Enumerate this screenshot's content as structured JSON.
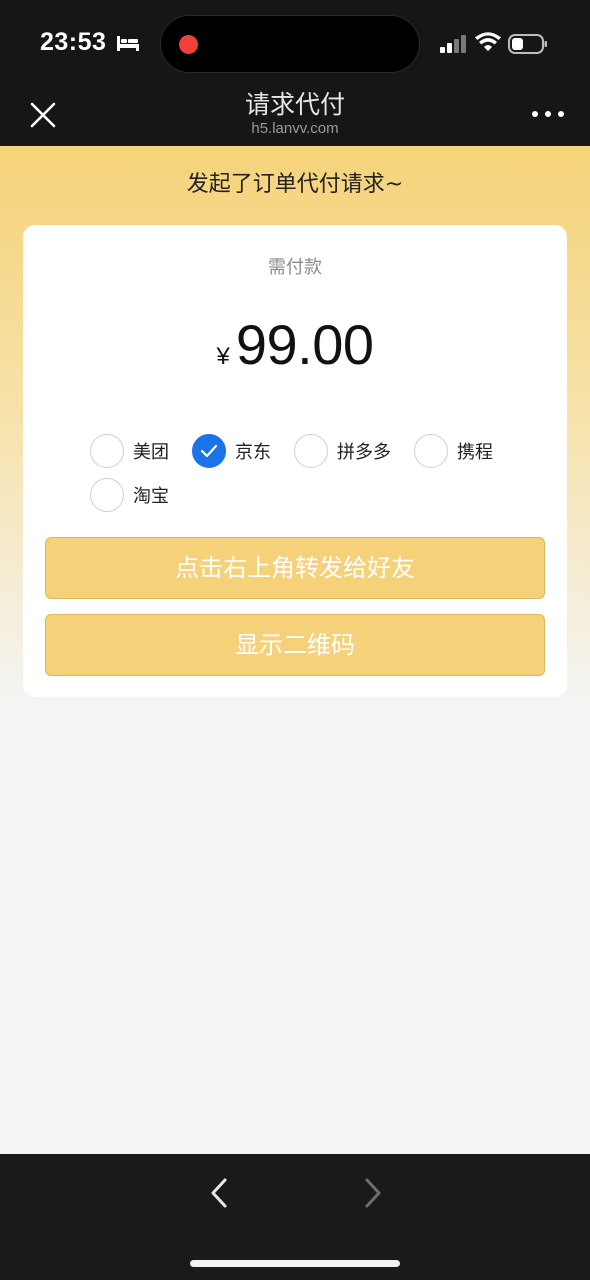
{
  "status_bar": {
    "time": "23:53",
    "icons": [
      "bed-icon",
      "recording-dot",
      "signal-icon",
      "wifi-icon",
      "battery-icon"
    ],
    "record_color": "#f0413a"
  },
  "nav": {
    "title": "请求代付",
    "subtitle": "h5.lanvv.com",
    "close_icon": "close-icon",
    "more_icon": "more-icon"
  },
  "hero": {
    "message": "发起了订单代付请求~"
  },
  "payment": {
    "label": "需付款",
    "currency": "¥",
    "amount": "99.00"
  },
  "platforms": [
    {
      "label": "美团",
      "checked": false
    },
    {
      "label": "京东",
      "checked": true
    },
    {
      "label": "拼多多",
      "checked": false
    },
    {
      "label": "携程",
      "checked": false
    },
    {
      "label": "淘宝",
      "checked": false
    }
  ],
  "buttons": {
    "share": "点击右上角转发给好友",
    "qr": "显示二维码"
  },
  "bottom_bar": {
    "back_icon": "chevron-left-icon",
    "forward_icon": "chevron-right-icon"
  },
  "colors": {
    "accent_yellow": "#f5d27a",
    "checked_blue": "#1a73e8",
    "dark_bar": "#161616"
  }
}
